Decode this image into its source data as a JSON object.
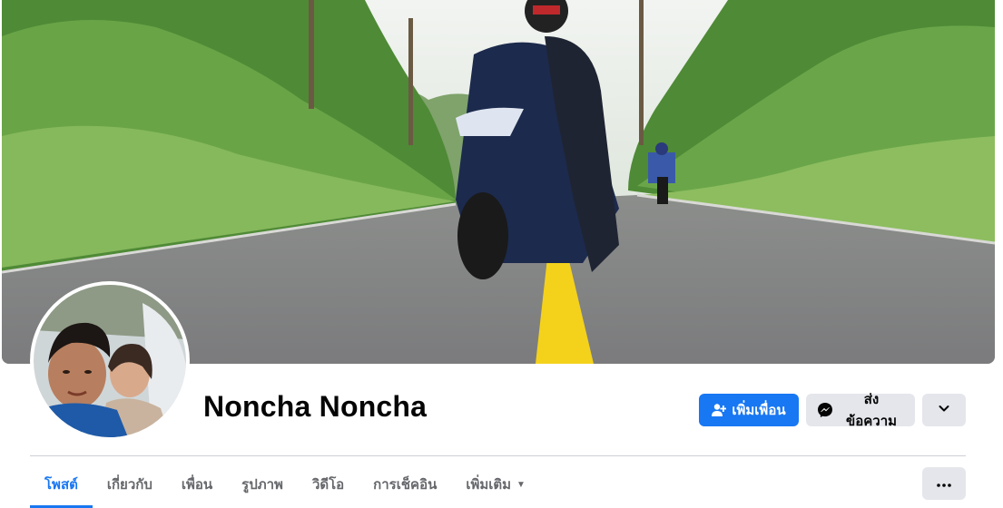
{
  "profile": {
    "name": "Noncha Noncha"
  },
  "actions": {
    "add_friend_label": "เพิ่มเพื่อน",
    "message_label": "ส่งข้อความ"
  },
  "tabs": [
    {
      "label": "โพสต์",
      "active": true
    },
    {
      "label": "เกี่ยวกับ",
      "active": false
    },
    {
      "label": "เพื่อน",
      "active": false
    },
    {
      "label": "รูปภาพ",
      "active": false
    },
    {
      "label": "วิดีโอ",
      "active": false
    },
    {
      "label": "การเช็คอิน",
      "active": false
    },
    {
      "label": "เพิ่มเติม",
      "active": false
    }
  ],
  "icons": {
    "add_friend": "person-add-icon",
    "message": "messenger-icon",
    "chevron": "chevron-down-icon",
    "more": "more-horizontal-icon",
    "caret": "caret-down-icon"
  },
  "colors": {
    "accent": "#1877f2",
    "button_secondary": "#e4e6eb",
    "text_primary": "#050505",
    "text_secondary": "#65676b"
  }
}
